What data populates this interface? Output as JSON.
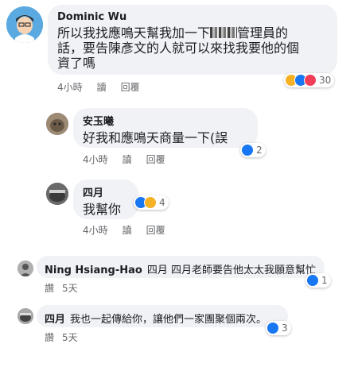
{
  "comments": [
    {
      "author": "Dominic Wu",
      "lines": [
        "所以我找應鳴天幫我加一下",
        "管理員的",
        "話，要告陳彥文的人就可以來找我要他的個",
        "資了嗎"
      ],
      "time": "4小時",
      "read": "讀",
      "reply": "回覆",
      "reaction_count": "30"
    },
    {
      "author": "安玉曦",
      "text": "好我和應鳴天商量一下(誤",
      "time": "4小時",
      "read": "讀",
      "reply": "回覆",
      "reaction_count": "2"
    },
    {
      "author": "四月",
      "text": "我幫你",
      "time": "4小時",
      "read": "讀",
      "reply": "回覆",
      "reaction_count": "4"
    },
    {
      "author": "Ning Hsiang-Hao",
      "text": "四月 四月老師要告他太太我願意幫忙",
      "read": "讚",
      "time": "5天",
      "reaction_count": "1"
    },
    {
      "author": "四月",
      "text": "我也一起傳給你，讓他們一家團聚個兩次。",
      "read": "讚",
      "time": "5天",
      "reaction_count": "3"
    }
  ],
  "colors": {
    "like": "#1877f2",
    "haha": "#f7b125",
    "love": "#f33e58",
    "bubble": "#f0f2f5"
  }
}
